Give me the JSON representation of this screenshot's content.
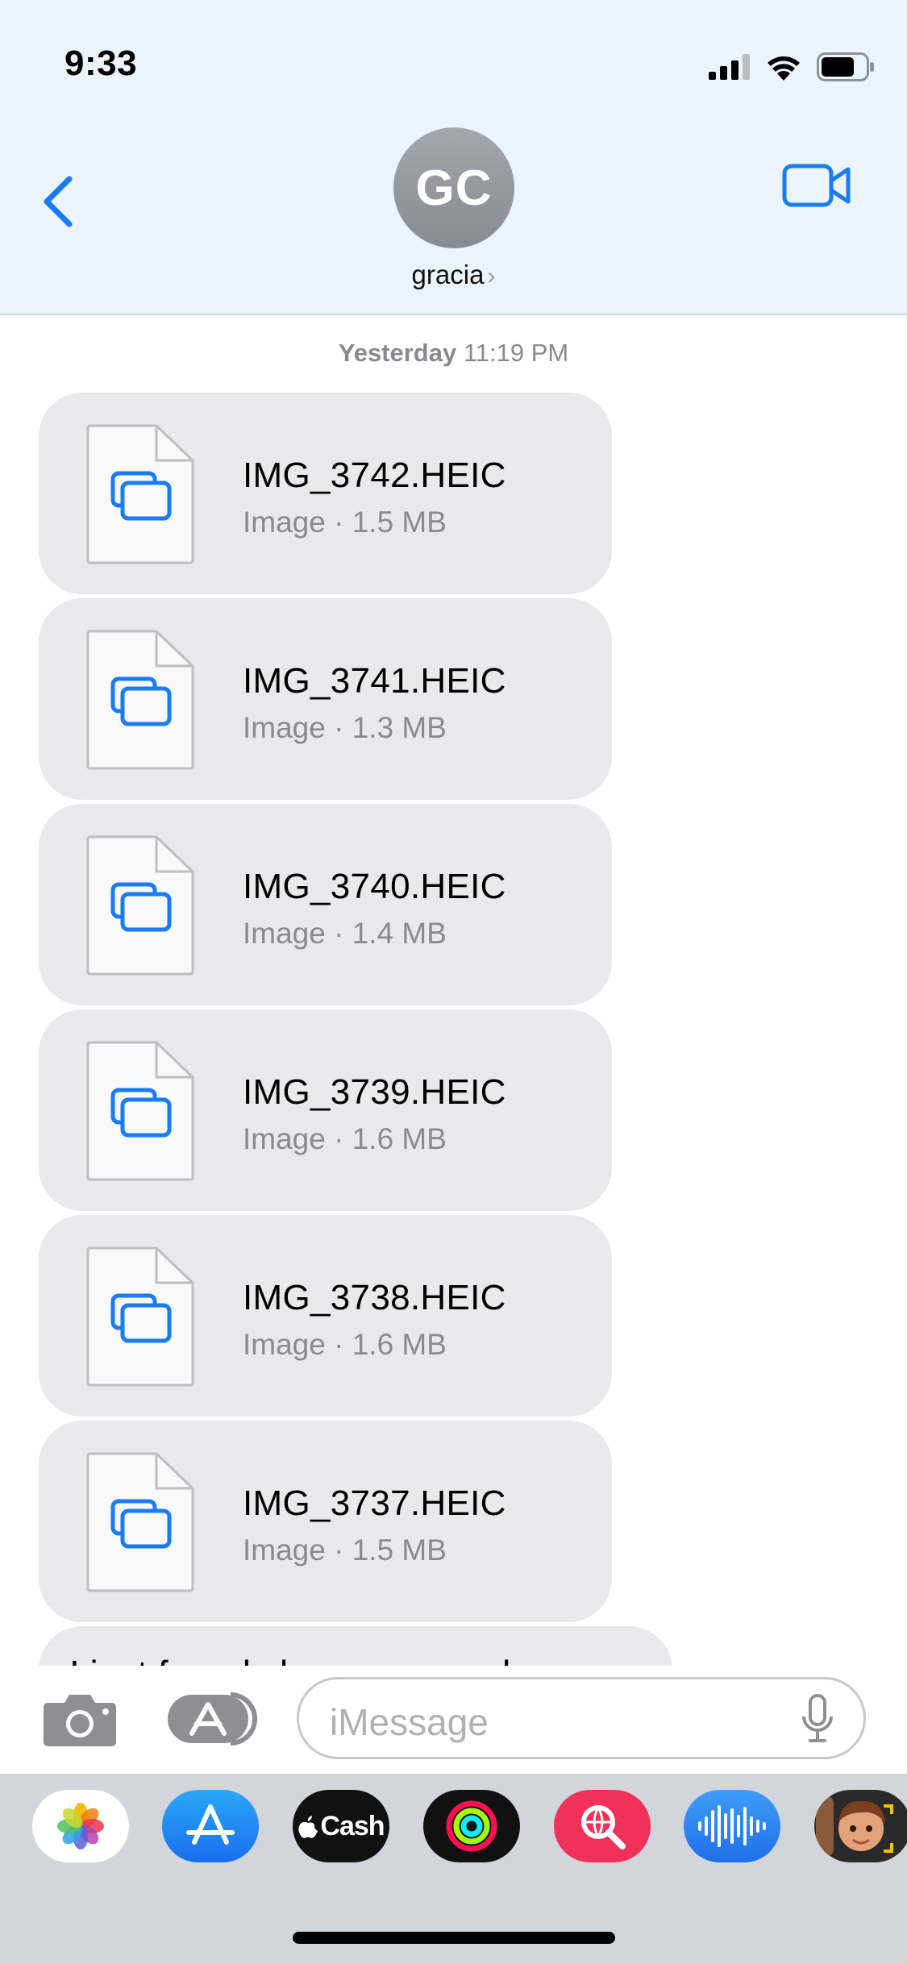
{
  "status_bar": {
    "time": "9:33"
  },
  "header": {
    "avatar_initials": "GC",
    "contact_name": "gracia",
    "chevron": "›"
  },
  "thread": {
    "timestamp_day": "Yesterday",
    "timestamp_time": "11:19 PM",
    "attachments": [
      {
        "name": "IMG_3742.HEIC",
        "meta": "Image · 1.5 MB"
      },
      {
        "name": "IMG_3741.HEIC",
        "meta": "Image · 1.3 MB"
      },
      {
        "name": "IMG_3740.HEIC",
        "meta": "Image · 1.4 MB"
      },
      {
        "name": "IMG_3739.HEIC",
        "meta": "Image · 1.6 MB"
      },
      {
        "name": "IMG_3738.HEIC",
        "meta": "Image · 1.6 MB"
      },
      {
        "name": "IMG_3737.HEIC",
        "meta": "Image · 1.5 MB"
      }
    ],
    "partial_message": "I just found vhese on my phone"
  },
  "compose": {
    "placeholder": "iMessage"
  },
  "drawer": {
    "apps": [
      {
        "name": "photos-app-icon"
      },
      {
        "name": "app-store-app-icon"
      },
      {
        "name": "apple-cash-app-icon",
        "label": "Cash"
      },
      {
        "name": "fitness-app-icon"
      },
      {
        "name": "images-search-app-icon"
      },
      {
        "name": "audio-message-app-icon"
      },
      {
        "name": "memoji-app-icon"
      }
    ]
  },
  "colors": {
    "accent": "#1a7cf5",
    "bubble": "#e9e9eb",
    "header_bg": "#ebf3fb"
  }
}
